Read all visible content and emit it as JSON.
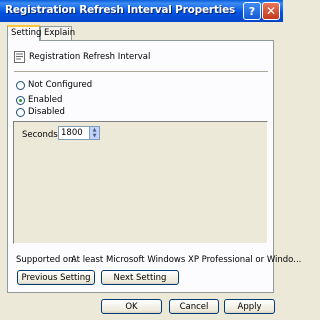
{
  "window": {
    "title": "Registration Refresh Interval Properties"
  },
  "tabs": [
    {
      "label": "Setting",
      "active": true
    },
    {
      "label": "Explain",
      "active": false
    }
  ],
  "policy": {
    "name": "Registration Refresh Interval",
    "icon": "policy-setting-icon"
  },
  "options": [
    {
      "label": "Not Configured",
      "checked": false
    },
    {
      "label": "Enabled",
      "checked": true
    },
    {
      "label": "Disabled",
      "checked": false
    }
  ],
  "seconds": {
    "label": "Seconds:",
    "value": "1800"
  },
  "supported": {
    "label": "Supported on:",
    "value": "At least Microsoft Windows XP Professional or Windo..."
  },
  "buttons": {
    "previous": "Previous Setting",
    "next": "Next Setting",
    "ok": "OK",
    "cancel": "Cancel",
    "apply": "Apply"
  },
  "colors": {
    "titlebar": "#0054e3",
    "dialog": "#ece9d8",
    "close_button": "#c33b1c"
  }
}
